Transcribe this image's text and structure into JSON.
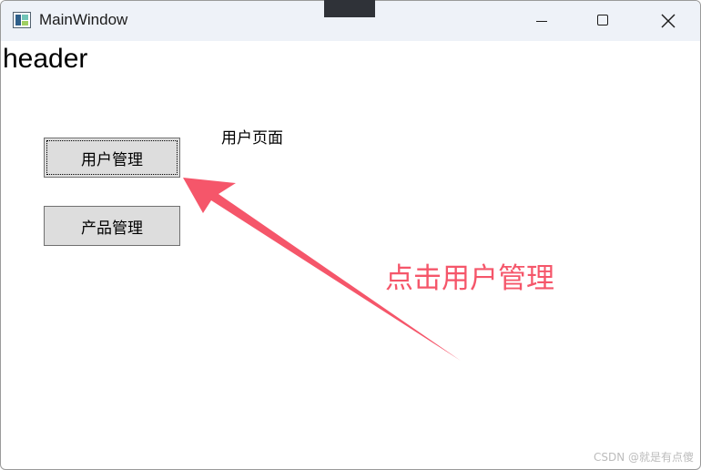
{
  "window": {
    "title": "MainWindow"
  },
  "header": {
    "text": "header"
  },
  "nav": {
    "items": [
      {
        "label": "用户管理",
        "focused": true
      },
      {
        "label": "产品管理",
        "focused": false
      }
    ]
  },
  "content": {
    "page_label": "用户页面"
  },
  "annotation": {
    "text": "点击用户管理",
    "color": "#f5566a"
  },
  "watermark": {
    "text": "CSDN @就是有点傻"
  },
  "icons": {
    "app": "app-window-icon",
    "minimize": "minimize-icon",
    "maximize": "maximize-icon",
    "close": "close-icon"
  }
}
